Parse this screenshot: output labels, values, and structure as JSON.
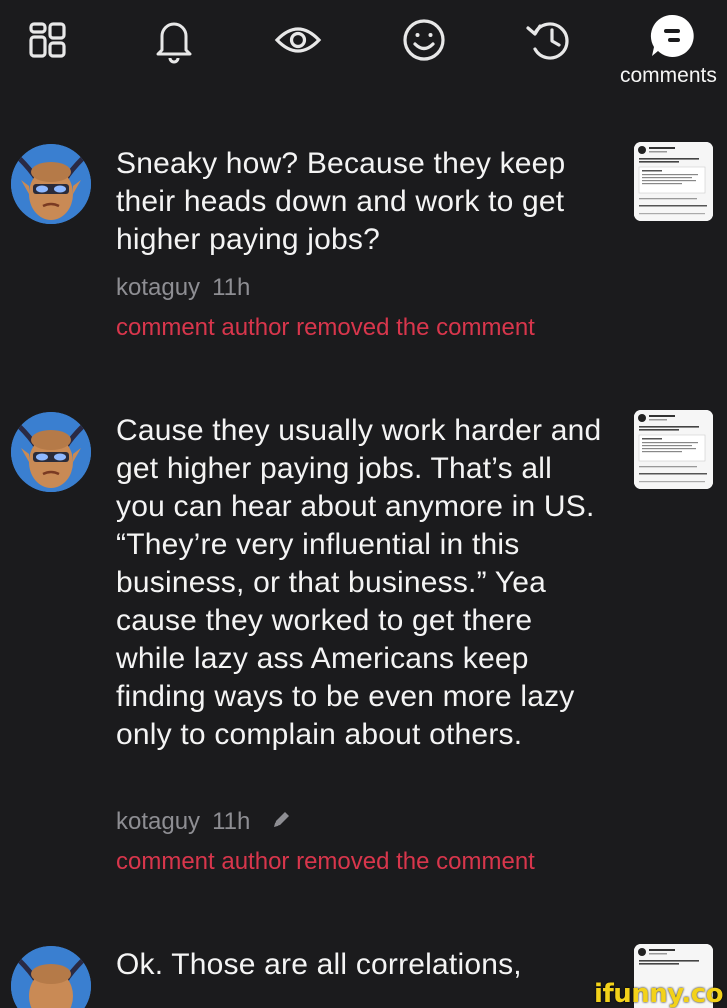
{
  "topbar": {
    "icons": [
      "sections-icon",
      "bell-icon",
      "eye-icon",
      "smiley-icon",
      "history-icon"
    ],
    "comments_label": "comments"
  },
  "comments": [
    {
      "text": "Sneaky how? Because they keep their heads down and work to get higher paying jobs?",
      "author": "kotaguy",
      "time": "11h",
      "removed_note": "comment author removed the comment"
    },
    {
      "text": "Cause they usually work harder and get higher paying jobs. That’s all you can hear about anymore in US. “They’re very influential in this business, or that business.” Yea cause they worked to get there while lazy ass Americans keep finding ways to be even more lazy only to complain about others.",
      "author": "kotaguy",
      "time": "11h",
      "edited": true,
      "removed_note": "comment author removed the comment"
    },
    {
      "text": "Ok. Those are all correlations,",
      "author": "",
      "time": ""
    }
  ],
  "colors": {
    "background": "#1b1b1d",
    "removed": "#d8364c",
    "meta": "#8e8e93",
    "avatar_bg": "#3a7fd0"
  },
  "watermark": "ifunny.co"
}
